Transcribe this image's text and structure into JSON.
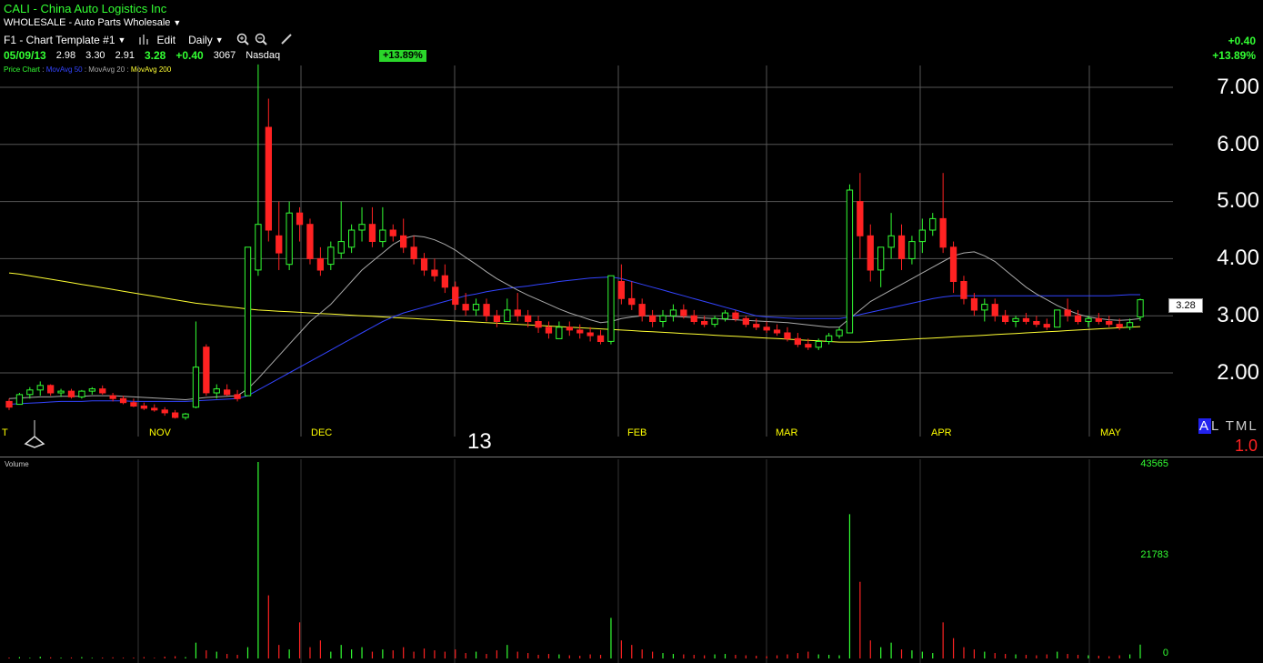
{
  "header": {
    "symbol_line": "CALI - China Auto Logistics Inc",
    "industry": "WHOLESALE - Auto Parts Wholesale"
  },
  "toolbar": {
    "template": "F1 - Chart Template #1",
    "edit": "Edit",
    "period": "Daily"
  },
  "quote": {
    "date": "05/09/13",
    "open": "2.98",
    "high": "3.30",
    "low": "2.91",
    "last": "3.28",
    "change": "+0.40",
    "volume": "3067",
    "exchange": "Nasdaq",
    "pct_badge": "+13.89%"
  },
  "right_summary": {
    "change": "+0.40",
    "pct": "+13.89%"
  },
  "legend": {
    "price_chart": "Price Chart",
    "ma50": "MovAvg 50",
    "ma20": "MovAvg 20",
    "ma200": "MovAvg 200",
    "separator": ":"
  },
  "price_axis": {
    "ticks": [
      "7.00",
      "6.00",
      "5.00",
      "4.00",
      "3.00",
      "2.00"
    ],
    "last_price_tag": "3.28"
  },
  "time_axis": {
    "months": [
      "T",
      "NOV",
      "DEC",
      "FEB",
      "MAR",
      "APR",
      "MAY"
    ],
    "year_label": "13"
  },
  "side_panel": {
    "altml_first": "A",
    "altml_rest": "L TML",
    "ratio": "1.0"
  },
  "volume_panel": {
    "label": "Volume",
    "ticks": [
      "43565",
      "21783",
      "0"
    ]
  },
  "colors": {
    "up": "#33ff33",
    "down": "#ff2222",
    "ma50": "#3344ff",
    "ma20": "#aaaaaa",
    "ma200": "#ffff33",
    "grid": "#555555",
    "background": "#000000"
  },
  "icons": [
    "zoom-in-icon",
    "zoom-out-icon",
    "draw-pen-icon",
    "bar-chart-icon",
    "event-marker-icon"
  ],
  "chart_data": [
    {
      "type": "candlestick",
      "title": "CALI - China Auto Logistics Inc",
      "ylim": [
        1.3,
        7.4
      ],
      "y_ticks": [
        2,
        3,
        4,
        5,
        6,
        7
      ],
      "x_ticks": [
        "T",
        "NOV",
        "DEC",
        "FEB",
        "MAR",
        "APR",
        "MAY"
      ],
      "ohlc": [
        [
          1.5,
          1.55,
          1.35,
          1.4
        ],
        [
          1.45,
          1.65,
          1.45,
          1.62
        ],
        [
          1.62,
          1.75,
          1.55,
          1.7
        ],
        [
          1.7,
          1.85,
          1.6,
          1.78
        ],
        [
          1.78,
          1.8,
          1.6,
          1.65
        ],
        [
          1.65,
          1.72,
          1.58,
          1.68
        ],
        [
          1.68,
          1.72,
          1.55,
          1.58
        ],
        [
          1.58,
          1.7,
          1.55,
          1.68
        ],
        [
          1.68,
          1.75,
          1.62,
          1.72
        ],
        [
          1.72,
          1.78,
          1.62,
          1.65
        ],
        [
          1.6,
          1.65,
          1.5,
          1.55
        ],
        [
          1.55,
          1.6,
          1.45,
          1.48
        ],
        [
          1.48,
          1.55,
          1.4,
          1.42
        ],
        [
          1.42,
          1.48,
          1.35,
          1.38
        ],
        [
          1.38,
          1.45,
          1.32,
          1.35
        ],
        [
          1.35,
          1.4,
          1.25,
          1.3
        ],
        [
          1.3,
          1.35,
          1.2,
          1.22
        ],
        [
          1.22,
          1.3,
          1.18,
          1.28
        ],
        [
          1.4,
          2.9,
          1.38,
          2.1
        ],
        [
          2.45,
          2.5,
          1.6,
          1.65
        ],
        [
          1.65,
          1.8,
          1.55,
          1.72
        ],
        [
          1.7,
          1.8,
          1.6,
          1.62
        ],
        [
          1.62,
          1.7,
          1.5,
          1.55
        ],
        [
          1.6,
          4.2,
          1.6,
          4.2
        ],
        [
          3.8,
          7.4,
          3.7,
          4.6
        ],
        [
          6.3,
          6.8,
          4.3,
          4.5
        ],
        [
          4.4,
          5.0,
          3.8,
          4.1
        ],
        [
          3.9,
          5.0,
          3.8,
          4.8
        ],
        [
          4.8,
          4.9,
          4.3,
          4.6
        ],
        [
          4.6,
          4.7,
          3.9,
          4.0
        ],
        [
          4.0,
          4.2,
          3.7,
          3.8
        ],
        [
          3.9,
          4.3,
          3.8,
          4.2
        ],
        [
          4.1,
          5.0,
          4.0,
          4.3
        ],
        [
          4.2,
          4.6,
          4.1,
          4.5
        ],
        [
          4.5,
          4.9,
          4.3,
          4.6
        ],
        [
          4.6,
          4.9,
          4.2,
          4.3
        ],
        [
          4.3,
          4.9,
          4.2,
          4.5
        ],
        [
          4.5,
          4.6,
          4.3,
          4.4
        ],
        [
          4.4,
          4.7,
          4.1,
          4.2
        ],
        [
          4.2,
          4.4,
          3.9,
          4.0
        ],
        [
          4.0,
          4.1,
          3.7,
          3.8
        ],
        [
          3.8,
          4.0,
          3.6,
          3.7
        ],
        [
          3.7,
          3.9,
          3.4,
          3.5
        ],
        [
          3.5,
          3.6,
          3.1,
          3.2
        ],
        [
          3.2,
          3.4,
          3.0,
          3.1
        ],
        [
          3.1,
          3.3,
          3.0,
          3.2
        ],
        [
          3.2,
          3.3,
          2.9,
          3.0
        ],
        [
          3.0,
          3.1,
          2.8,
          2.9
        ],
        [
          2.9,
          3.3,
          2.9,
          3.1
        ],
        [
          3.1,
          3.4,
          2.9,
          3.0
        ],
        [
          3.0,
          3.1,
          2.8,
          2.9
        ],
        [
          2.9,
          3.0,
          2.7,
          2.8
        ],
        [
          2.8,
          2.9,
          2.6,
          2.7
        ],
        [
          2.6,
          2.9,
          2.6,
          2.8
        ],
        [
          2.8,
          2.9,
          2.65,
          2.75
        ],
        [
          2.75,
          2.85,
          2.6,
          2.7
        ],
        [
          2.7,
          2.8,
          2.55,
          2.65
        ],
        [
          2.65,
          2.75,
          2.5,
          2.55
        ],
        [
          2.55,
          3.7,
          2.5,
          3.7
        ],
        [
          3.6,
          3.9,
          3.2,
          3.3
        ],
        [
          3.3,
          3.6,
          3.1,
          3.2
        ],
        [
          3.2,
          3.3,
          2.9,
          3.0
        ],
        [
          3.0,
          3.1,
          2.8,
          2.9
        ],
        [
          2.9,
          3.1,
          2.8,
          3.0
        ],
        [
          3.0,
          3.2,
          2.9,
          3.1
        ],
        [
          3.1,
          3.2,
          2.95,
          3.0
        ],
        [
          3.0,
          3.1,
          2.85,
          2.9
        ],
        [
          2.9,
          3.0,
          2.8,
          2.85
        ],
        [
          2.85,
          3.0,
          2.8,
          2.95
        ],
        [
          2.95,
          3.1,
          2.9,
          3.05
        ],
        [
          3.05,
          3.1,
          2.9,
          2.95
        ],
        [
          2.95,
          3.0,
          2.8,
          2.85
        ],
        [
          2.85,
          2.95,
          2.75,
          2.8
        ],
        [
          2.8,
          2.9,
          2.7,
          2.75
        ],
        [
          2.75,
          2.85,
          2.65,
          2.7
        ],
        [
          2.7,
          2.8,
          2.55,
          2.6
        ],
        [
          2.6,
          2.7,
          2.45,
          2.5
        ],
        [
          2.5,
          2.6,
          2.4,
          2.45
        ],
        [
          2.45,
          2.6,
          2.4,
          2.55
        ],
        [
          2.55,
          2.7,
          2.5,
          2.65
        ],
        [
          2.65,
          2.8,
          2.6,
          2.75
        ],
        [
          2.7,
          5.3,
          2.7,
          5.2
        ],
        [
          5.0,
          5.5,
          4.0,
          4.4
        ],
        [
          4.4,
          4.6,
          3.6,
          3.8
        ],
        [
          3.8,
          4.2,
          3.5,
          4.2
        ],
        [
          4.2,
          4.8,
          4.0,
          4.4
        ],
        [
          4.4,
          4.6,
          3.8,
          4.0
        ],
        [
          4.0,
          4.4,
          3.9,
          4.3
        ],
        [
          4.3,
          4.7,
          4.1,
          4.5
        ],
        [
          4.5,
          4.8,
          4.4,
          4.7
        ],
        [
          4.7,
          5.5,
          4.1,
          4.2
        ],
        [
          4.2,
          4.3,
          3.4,
          3.6
        ],
        [
          3.6,
          3.7,
          3.2,
          3.3
        ],
        [
          3.3,
          3.4,
          3.0,
          3.1
        ],
        [
          3.1,
          3.3,
          2.9,
          3.2
        ],
        [
          3.2,
          3.3,
          2.9,
          3.0
        ],
        [
          3.0,
          3.1,
          2.85,
          2.9
        ],
        [
          2.9,
          3.0,
          2.8,
          2.95
        ],
        [
          2.95,
          3.05,
          2.85,
          2.9
        ],
        [
          2.9,
          3.0,
          2.8,
          2.85
        ],
        [
          2.85,
          2.95,
          2.75,
          2.8
        ],
        [
          2.8,
          3.1,
          2.8,
          3.1
        ],
        [
          3.1,
          3.3,
          2.9,
          3.0
        ],
        [
          3.0,
          3.1,
          2.85,
          2.9
        ],
        [
          2.9,
          3.0,
          2.8,
          2.95
        ],
        [
          2.95,
          3.05,
          2.85,
          2.9
        ],
        [
          2.9,
          3.0,
          2.8,
          2.85
        ],
        [
          2.85,
          2.95,
          2.75,
          2.8
        ],
        [
          2.8,
          2.95,
          2.75,
          2.88
        ],
        [
          2.98,
          3.3,
          2.91,
          3.28
        ]
      ],
      "ma20": [
        1.55,
        1.56,
        1.57,
        1.58,
        1.58,
        1.59,
        1.59,
        1.59,
        1.6,
        1.6,
        1.6,
        1.59,
        1.58,
        1.57,
        1.56,
        1.55,
        1.54,
        1.53,
        1.55,
        1.57,
        1.58,
        1.59,
        1.6,
        1.72,
        1.9,
        2.1,
        2.3,
        2.5,
        2.7,
        2.9,
        3.05,
        3.2,
        3.4,
        3.6,
        3.8,
        3.95,
        4.1,
        4.25,
        4.35,
        4.4,
        4.38,
        4.33,
        4.25,
        4.15,
        4.02,
        3.9,
        3.77,
        3.65,
        3.55,
        3.45,
        3.36,
        3.28,
        3.2,
        3.12,
        3.05,
        2.99,
        2.93,
        2.88,
        2.9,
        2.95,
        2.98,
        3.0,
        3.0,
        3.0,
        2.99,
        2.98,
        2.97,
        2.96,
        2.95,
        2.94,
        2.93,
        2.92,
        2.91,
        2.9,
        2.89,
        2.88,
        2.86,
        2.84,
        2.82,
        2.8,
        2.8,
        2.95,
        3.1,
        3.25,
        3.35,
        3.45,
        3.55,
        3.65,
        3.75,
        3.85,
        3.95,
        4.05,
        4.1,
        4.12,
        4.05,
        3.95,
        3.8,
        3.65,
        3.5,
        3.38,
        3.28,
        3.18,
        3.1,
        3.03,
        2.98,
        2.95,
        2.93,
        2.92,
        2.93,
        2.95
      ],
      "ma50": [
        1.45,
        1.46,
        1.47,
        1.48,
        1.49,
        1.5,
        1.5,
        1.5,
        1.51,
        1.51,
        1.51,
        1.51,
        1.5,
        1.5,
        1.5,
        1.5,
        1.5,
        1.5,
        1.51,
        1.52,
        1.53,
        1.54,
        1.55,
        1.6,
        1.7,
        1.8,
        1.9,
        2.0,
        2.1,
        2.2,
        2.3,
        2.4,
        2.5,
        2.6,
        2.7,
        2.8,
        2.9,
        2.98,
        3.05,
        3.1,
        3.15,
        3.2,
        3.25,
        3.3,
        3.35,
        3.38,
        3.42,
        3.45,
        3.48,
        3.5,
        3.52,
        3.55,
        3.57,
        3.6,
        3.62,
        3.64,
        3.66,
        3.67,
        3.68,
        3.65,
        3.6,
        3.55,
        3.5,
        3.45,
        3.4,
        3.35,
        3.3,
        3.25,
        3.2,
        3.15,
        3.1,
        3.05,
        3.0,
        2.98,
        2.97,
        2.96,
        2.95,
        2.95,
        2.95,
        2.95,
        2.95,
        2.98,
        3.02,
        3.06,
        3.1,
        3.14,
        3.18,
        3.22,
        3.26,
        3.3,
        3.33,
        3.35,
        3.35,
        3.35,
        3.35,
        3.35,
        3.35,
        3.35,
        3.35,
        3.35,
        3.35,
        3.35,
        3.35,
        3.35,
        3.35,
        3.35,
        3.35,
        3.36,
        3.37,
        3.37
      ],
      "ma200": [
        3.75,
        3.73,
        3.7,
        3.67,
        3.64,
        3.61,
        3.58,
        3.55,
        3.52,
        3.49,
        3.46,
        3.43,
        3.4,
        3.37,
        3.34,
        3.31,
        3.28,
        3.25,
        3.22,
        3.2,
        3.18,
        3.16,
        3.14,
        3.12,
        3.1,
        3.09,
        3.08,
        3.07,
        3.06,
        3.05,
        3.04,
        3.03,
        3.02,
        3.01,
        3.0,
        2.99,
        2.98,
        2.97,
        2.96,
        2.95,
        2.94,
        2.93,
        2.92,
        2.91,
        2.9,
        2.89,
        2.88,
        2.87,
        2.86,
        2.85,
        2.84,
        2.83,
        2.82,
        2.81,
        2.8,
        2.79,
        2.78,
        2.77,
        2.76,
        2.75,
        2.74,
        2.73,
        2.72,
        2.71,
        2.7,
        2.69,
        2.68,
        2.67,
        2.66,
        2.65,
        2.64,
        2.63,
        2.62,
        2.61,
        2.6,
        2.59,
        2.58,
        2.57,
        2.56,
        2.55,
        2.54,
        2.54,
        2.54,
        2.55,
        2.56,
        2.57,
        2.58,
        2.59,
        2.6,
        2.61,
        2.62,
        2.63,
        2.64,
        2.65,
        2.66,
        2.67,
        2.68,
        2.69,
        2.7,
        2.71,
        2.72,
        2.73,
        2.74,
        2.75,
        2.76,
        2.77,
        2.78,
        2.79,
        2.8,
        2.81
      ]
    },
    {
      "type": "bar",
      "title": "Volume",
      "ylim": [
        0,
        43565
      ],
      "y_ticks": [
        0,
        21783,
        43565
      ],
      "values": [
        200,
        300,
        150,
        400,
        250,
        180,
        220,
        300,
        150,
        200,
        250,
        180,
        200,
        300,
        150,
        400,
        500,
        300,
        3500,
        1800,
        1500,
        1000,
        800,
        2500,
        43565,
        14000,
        3000,
        2000,
        8000,
        2500,
        4000,
        1500,
        3000,
        2000,
        2500,
        1500,
        2000,
        1800,
        2500,
        1500,
        2200,
        1800,
        1500,
        2000,
        1200,
        1500,
        1000,
        1800,
        3000,
        1500,
        1200,
        800,
        1000,
        900,
        700,
        600,
        900,
        800,
        9000,
        4000,
        3000,
        2000,
        1500,
        1200,
        1000,
        900,
        800,
        700,
        900,
        1000,
        800,
        700,
        600,
        500,
        700,
        900,
        1200,
        1500,
        900,
        800,
        700,
        32000,
        17000,
        4000,
        2500,
        3500,
        2000,
        1800,
        1500,
        1200,
        8000,
        4500,
        2500,
        2000,
        1500,
        1200,
        1000,
        900,
        800,
        700,
        900,
        1500,
        1000,
        800,
        700,
        600,
        500,
        700,
        900,
        3067
      ]
    }
  ]
}
